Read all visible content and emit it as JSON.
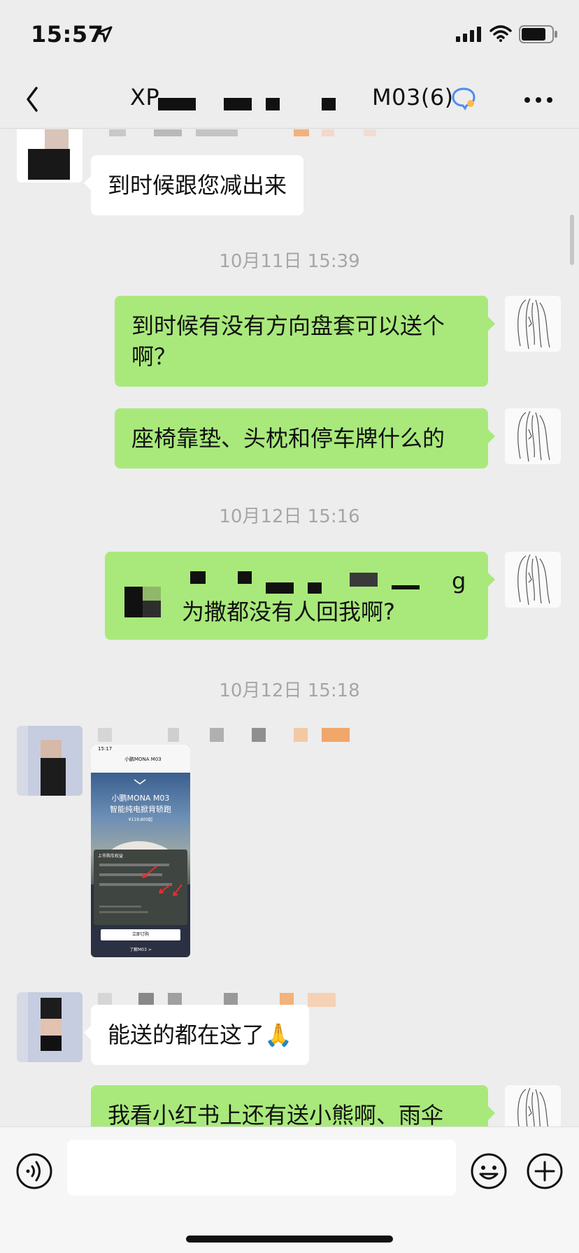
{
  "status_bar": {
    "time": "15:57",
    "location_icon": "location-arrow-icon",
    "signal_icon": "cellular-signal-icon",
    "wifi_icon": "wifi-icon",
    "battery_icon": "battery-icon"
  },
  "header": {
    "title_start": "XP",
    "title_end": "M03(6)",
    "back_icon": "chevron-left-icon",
    "group_icon": "group-chat-icon",
    "more_icon": "more-dots-icon"
  },
  "messages": [
    {
      "type": "text",
      "from": "other",
      "text": "到时候跟您减出来"
    },
    {
      "type": "timestamp",
      "text": "10月11日 15:39"
    },
    {
      "type": "text",
      "from": "me",
      "text": "到时候有没有方向盘套可以送个啊？"
    },
    {
      "type": "text",
      "from": "me",
      "text": "座椅靠垫、头枕和停车牌什么的"
    },
    {
      "type": "timestamp",
      "text": "10月12日 15:16"
    },
    {
      "type": "text",
      "from": "me",
      "text_visible_line1_end": "g",
      "text_visible_line2": "为撒都没有人回我啊?"
    },
    {
      "type": "timestamp",
      "text": "10月12日 15:18"
    },
    {
      "type": "image",
      "from": "other",
      "image": {
        "time": "15:17",
        "app_title": "小鹏MONA M03",
        "logo": "xpeng-logo-icon",
        "headline1": "小鹏MONA M03",
        "headline2": "智能纯电掀背轿跑",
        "price": "¥119,800起",
        "section_title": "上市购车权益",
        "primary_button": "立即订购",
        "secondary_link": "了解M03 >"
      }
    },
    {
      "type": "text",
      "from": "other",
      "text": "能送的都在这了🙏"
    },
    {
      "type": "text",
      "from": "me",
      "text": "我看小红书上还有送小熊啊、雨伞"
    }
  ],
  "input_bar": {
    "voice_icon": "voice-input-icon",
    "emoji_icon": "emoji-icon",
    "plus_icon": "plus-circle-icon",
    "placeholder": ""
  },
  "colors": {
    "background": "#ededed",
    "bubble_out": "#a9e97b",
    "bubble_in": "#ffffff",
    "timestamp": "#a6a6a6"
  }
}
